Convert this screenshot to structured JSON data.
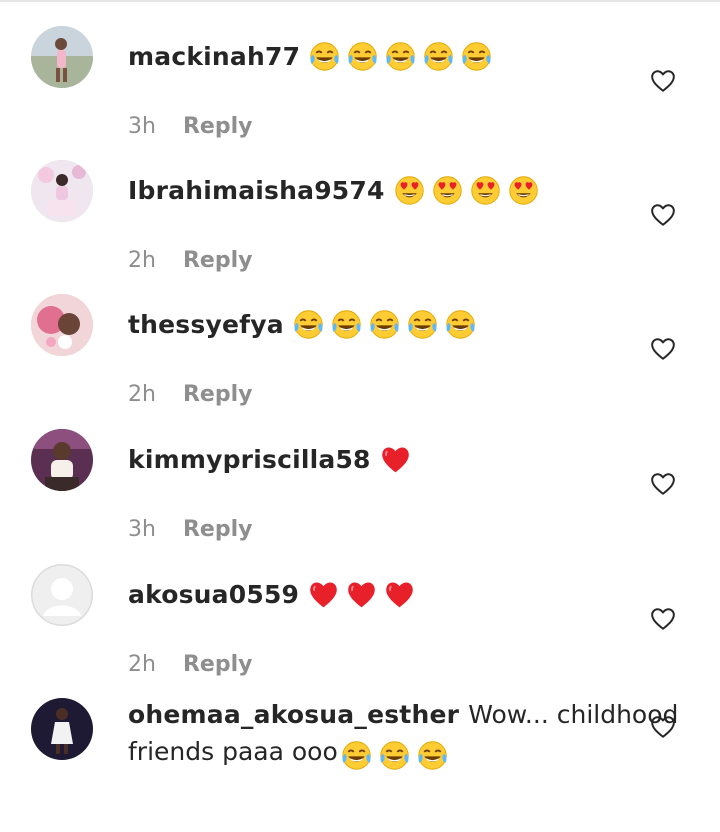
{
  "comments": [
    {
      "username": "mackinah77",
      "text": "",
      "emojis": [
        "tears-of-joy",
        "tears-of-joy",
        "tears-of-joy",
        "tears-of-joy",
        "tears-of-joy"
      ],
      "time": "3h",
      "reply_label": "Reply",
      "avatar": "photo"
    },
    {
      "username": "Ibrahimaisha9574",
      "text": "",
      "emojis": [
        "heart-eyes",
        "heart-eyes",
        "heart-eyes",
        "heart-eyes"
      ],
      "time": "2h",
      "reply_label": "Reply",
      "avatar": "photo"
    },
    {
      "username": "thessyefya",
      "text": "",
      "emojis": [
        "tears-of-joy",
        "tears-of-joy",
        "tears-of-joy",
        "tears-of-joy",
        "tears-of-joy"
      ],
      "time": "2h",
      "reply_label": "Reply",
      "avatar": "photo"
    },
    {
      "username": "kimmypriscilla58",
      "text": "",
      "emojis": [
        "red-heart"
      ],
      "time": "3h",
      "reply_label": "Reply",
      "avatar": "photo"
    },
    {
      "username": "akosua0559",
      "text": "",
      "emojis": [
        "red-heart",
        "red-heart",
        "red-heart"
      ],
      "time": "2h",
      "reply_label": "Reply",
      "avatar": "default"
    },
    {
      "username": "ohemaa_akosua_esther",
      "text": "Wow... childhood friends paaa ooo",
      "emojis": [
        "tears-of-joy",
        "tears-of-joy",
        "tears-of-joy"
      ],
      "avatar": "photo"
    }
  ],
  "like_icon": "heart-outline-icon",
  "colors": {
    "username": "#262626",
    "meta": "#8e8e8e",
    "emoji_face": "#ffcc33",
    "emoji_heart": "#e8202a"
  }
}
